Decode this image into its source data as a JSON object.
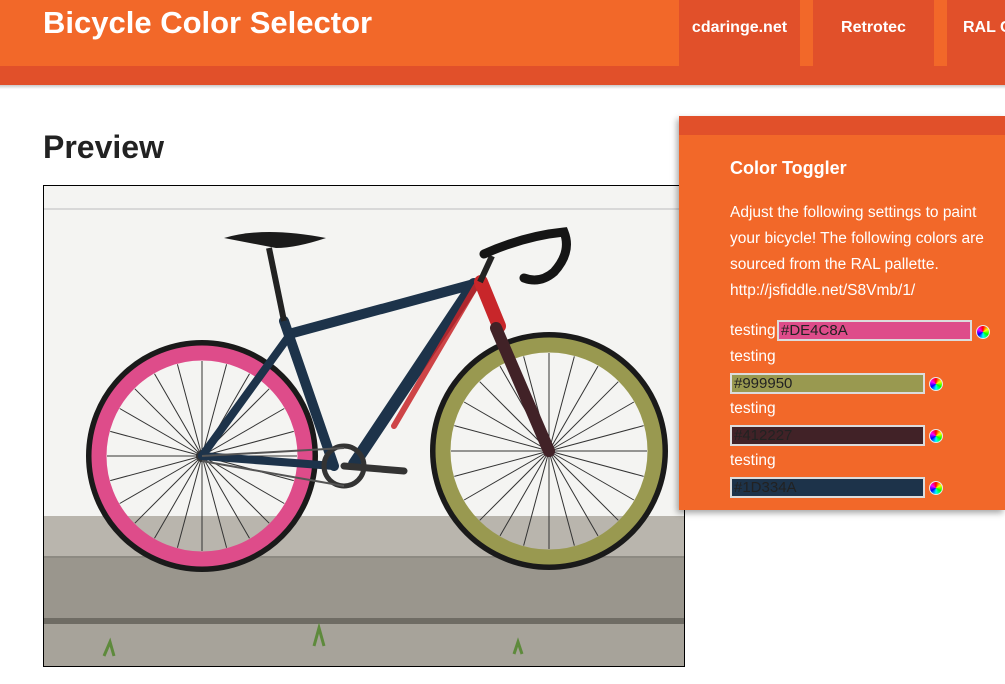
{
  "header": {
    "title": "Bicycle Color Selector",
    "nav": [
      "cdaringe.net",
      "Retrotec",
      "RAL C"
    ]
  },
  "preview": {
    "title": "Preview"
  },
  "panel": {
    "title": "Color Toggler",
    "description": "Adjust the following settings to paint your bicycle! The following colors are sourced from the RAL pallette. http://jsfiddle.net/S8Vmb/1/",
    "settings": [
      {
        "label": "testing",
        "value": "#DE4C8A",
        "color": "#DE4C8A"
      },
      {
        "label": "testing",
        "value": "#999950",
        "color": "#999950"
      },
      {
        "label": "testing",
        "value": "#412227",
        "color": "#412227"
      },
      {
        "label": "testing",
        "value": "#1D334A",
        "color": "#1D334A"
      }
    ]
  },
  "colors": {
    "header": "#f26829",
    "header_dark": "#e1502a",
    "frame": "#1D334A",
    "fork": "#412227",
    "front_rim": "#999950",
    "rear_rim": "#DE4C8A",
    "accent_red": "#c8262a"
  }
}
